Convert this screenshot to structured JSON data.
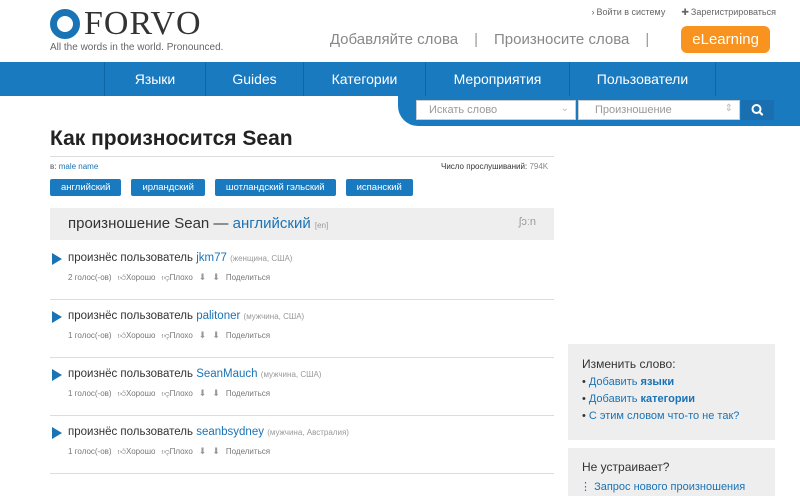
{
  "header": {
    "logo_text": "FORVO",
    "tagline": "All the words in the world. Pronounced.",
    "login": "Войти в систему",
    "register": "Зарегистрироваться",
    "add_words": "Добавляйте слова",
    "pronounce_words": "Произносите слова",
    "elearning": "eLearning"
  },
  "nav": {
    "items": [
      "Языки",
      "Guides",
      "Категории",
      "Мероприятия",
      "Пользователи"
    ]
  },
  "search": {
    "placeholder": "Искать слово",
    "mode": "Произношение"
  },
  "page": {
    "title": "Как произносится Sean",
    "in_label": "в:",
    "category": "male name",
    "listens_label": "Число прослушиваний:",
    "listens_value": "794K",
    "tags": [
      "английский",
      "ирландский",
      "шотландский гэльский",
      "испанский"
    ]
  },
  "section": {
    "prefix": "произношение Sean —",
    "language": "английский",
    "code": "[en]",
    "ipa": "ʃɔːn"
  },
  "entries": [
    {
      "by": "произнёс пользователь",
      "user": "jkm77",
      "info": "(женщина, США)",
      "votes": "2 голос(-ов)"
    },
    {
      "by": "произнёс пользователь",
      "user": "palitoner",
      "info": "(мужчина, США)",
      "votes": "1 голос(-ов)"
    },
    {
      "by": "произнёс пользователь",
      "user": "SeanMauch",
      "info": "(мужчина, США)",
      "votes": "1 голос(-ов)"
    },
    {
      "by": "произнёс пользователь",
      "user": "seanbsydney",
      "info": "(мужчина, Австралия)",
      "votes": "1 голос(-ов)"
    }
  ],
  "entry_actions": {
    "good": "Хорошо",
    "bad": "Плохо",
    "share": "Поделиться"
  },
  "sidebar": {
    "edit_title": "Изменить слово:",
    "add_label": "Добавить",
    "languages": "языки",
    "categories": "категории",
    "problem": "С этим словом что-то не так?",
    "unsatisfied_title": "Не устраивает?",
    "request": "Запрос нового произношения"
  },
  "colors": {
    "brand_blue": "#1a7abf",
    "elearning_orange": "#f7931e"
  }
}
